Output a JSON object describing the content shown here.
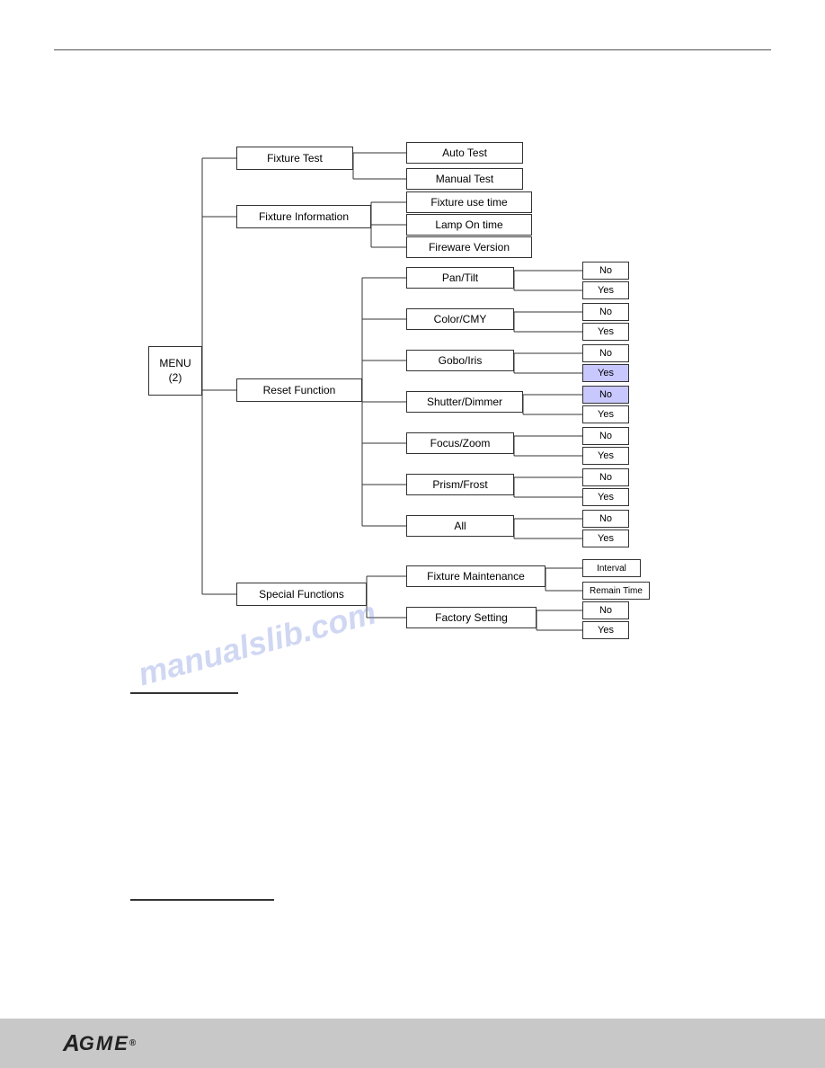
{
  "diagram": {
    "menu_label": "MENU\n(2)",
    "level1": {
      "fixture_test": "Fixture Test",
      "fixture_info": "Fixture Information",
      "reset_func": "Reset Function",
      "special_func": "Special Functions"
    },
    "fixture_test_items": [
      "Auto Test",
      "Manual Test"
    ],
    "fixture_info_items": [
      "Fixture use time",
      "Lamp On time",
      "Fireware Version"
    ],
    "reset_func_items": [
      "Pan/Tilt",
      "Color/CMY",
      "Gobo/Iris",
      "Shutter/Dimmer",
      "Focus/Zoom",
      "Prism/Frost",
      "All"
    ],
    "special_func_items": {
      "fixture_maint": "Fixture Maintenance",
      "factory_setting": "Factory Setting",
      "maint_sub": [
        "Interval",
        "Remain Time"
      ]
    },
    "yes_label": "Yes",
    "no_label": "No"
  },
  "footer": {
    "logo": "ACME",
    "tm": "®"
  }
}
